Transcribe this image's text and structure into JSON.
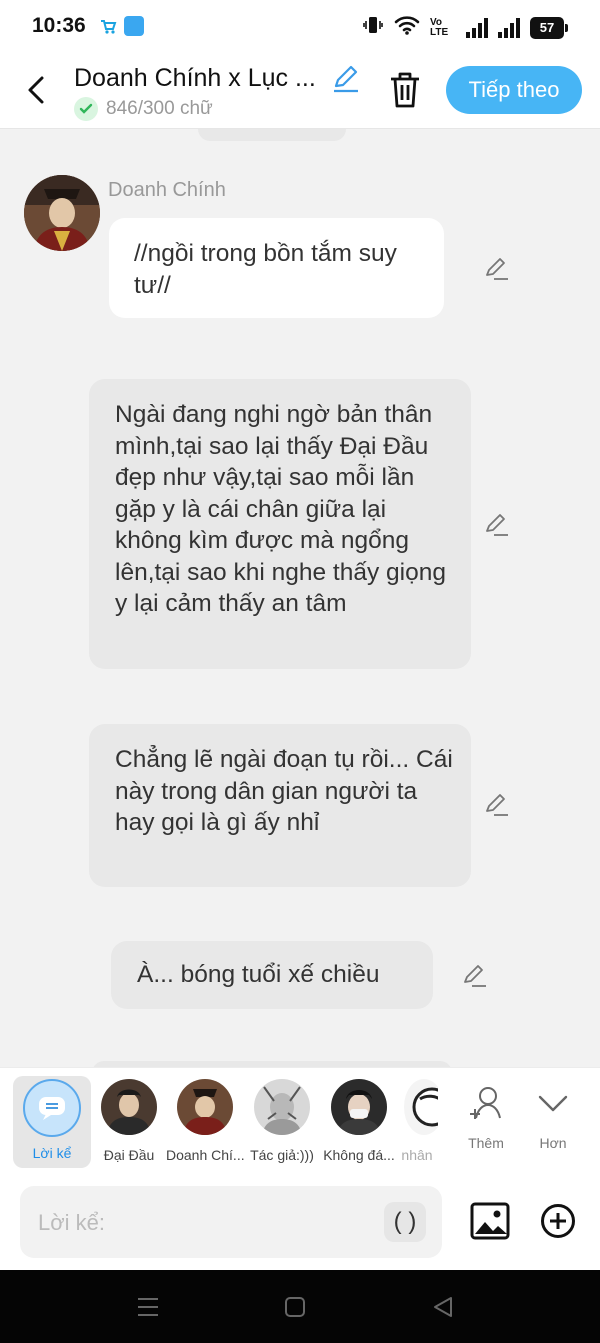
{
  "status_bar": {
    "time": "10:36",
    "network_label": "Vo LTE",
    "battery": "57"
  },
  "header": {
    "title": "Doanh Chính x Lục ...",
    "word_count": "846/300 chữ",
    "next_label": "Tiếp theo"
  },
  "chat": {
    "speaker": "Doanh Chính",
    "messages": [
      {
        "text": "//ngồi trong bồn tắm suy tư//",
        "style": "white"
      },
      {
        "text": "Ngài đang nghi ngờ bản thân mình,tại sao lại thấy Đại Đầu đẹp như vậy,tại sao mỗi lần gặp y là cái chân giữa lại không kìm được mà ngổng lên,tại sao khi nghe thấy giọng y lại cảm thấy an tâm",
        "style": "grey"
      },
      {
        "text": "Chẳng lẽ ngài đoạn tụ rồi... Cái này trong dân gian người ta hay gọi là gì ấy nhỉ",
        "style": "grey"
      },
      {
        "text": "À...  bóng tuổi xế chiều",
        "style": "grey"
      }
    ]
  },
  "characters": [
    {
      "name": "Lời kể",
      "selected": true
    },
    {
      "name": "Đại Đầu",
      "selected": false
    },
    {
      "name": "Doanh Chí...",
      "selected": false
    },
    {
      "name": "Tác giả:)))",
      "selected": false
    },
    {
      "name": "Không đá...",
      "selected": false
    },
    {
      "name": "nhân",
      "selected": false
    }
  ],
  "tools": {
    "add_label": "Thêm",
    "more_label": "Hơn"
  },
  "input": {
    "placeholder": "Lời kể:",
    "paren_label": "( )"
  },
  "colors": {
    "accent": "#47b5f5",
    "selected_name": "#1f8ee8",
    "bubble_grey": "#e8e8e8"
  }
}
